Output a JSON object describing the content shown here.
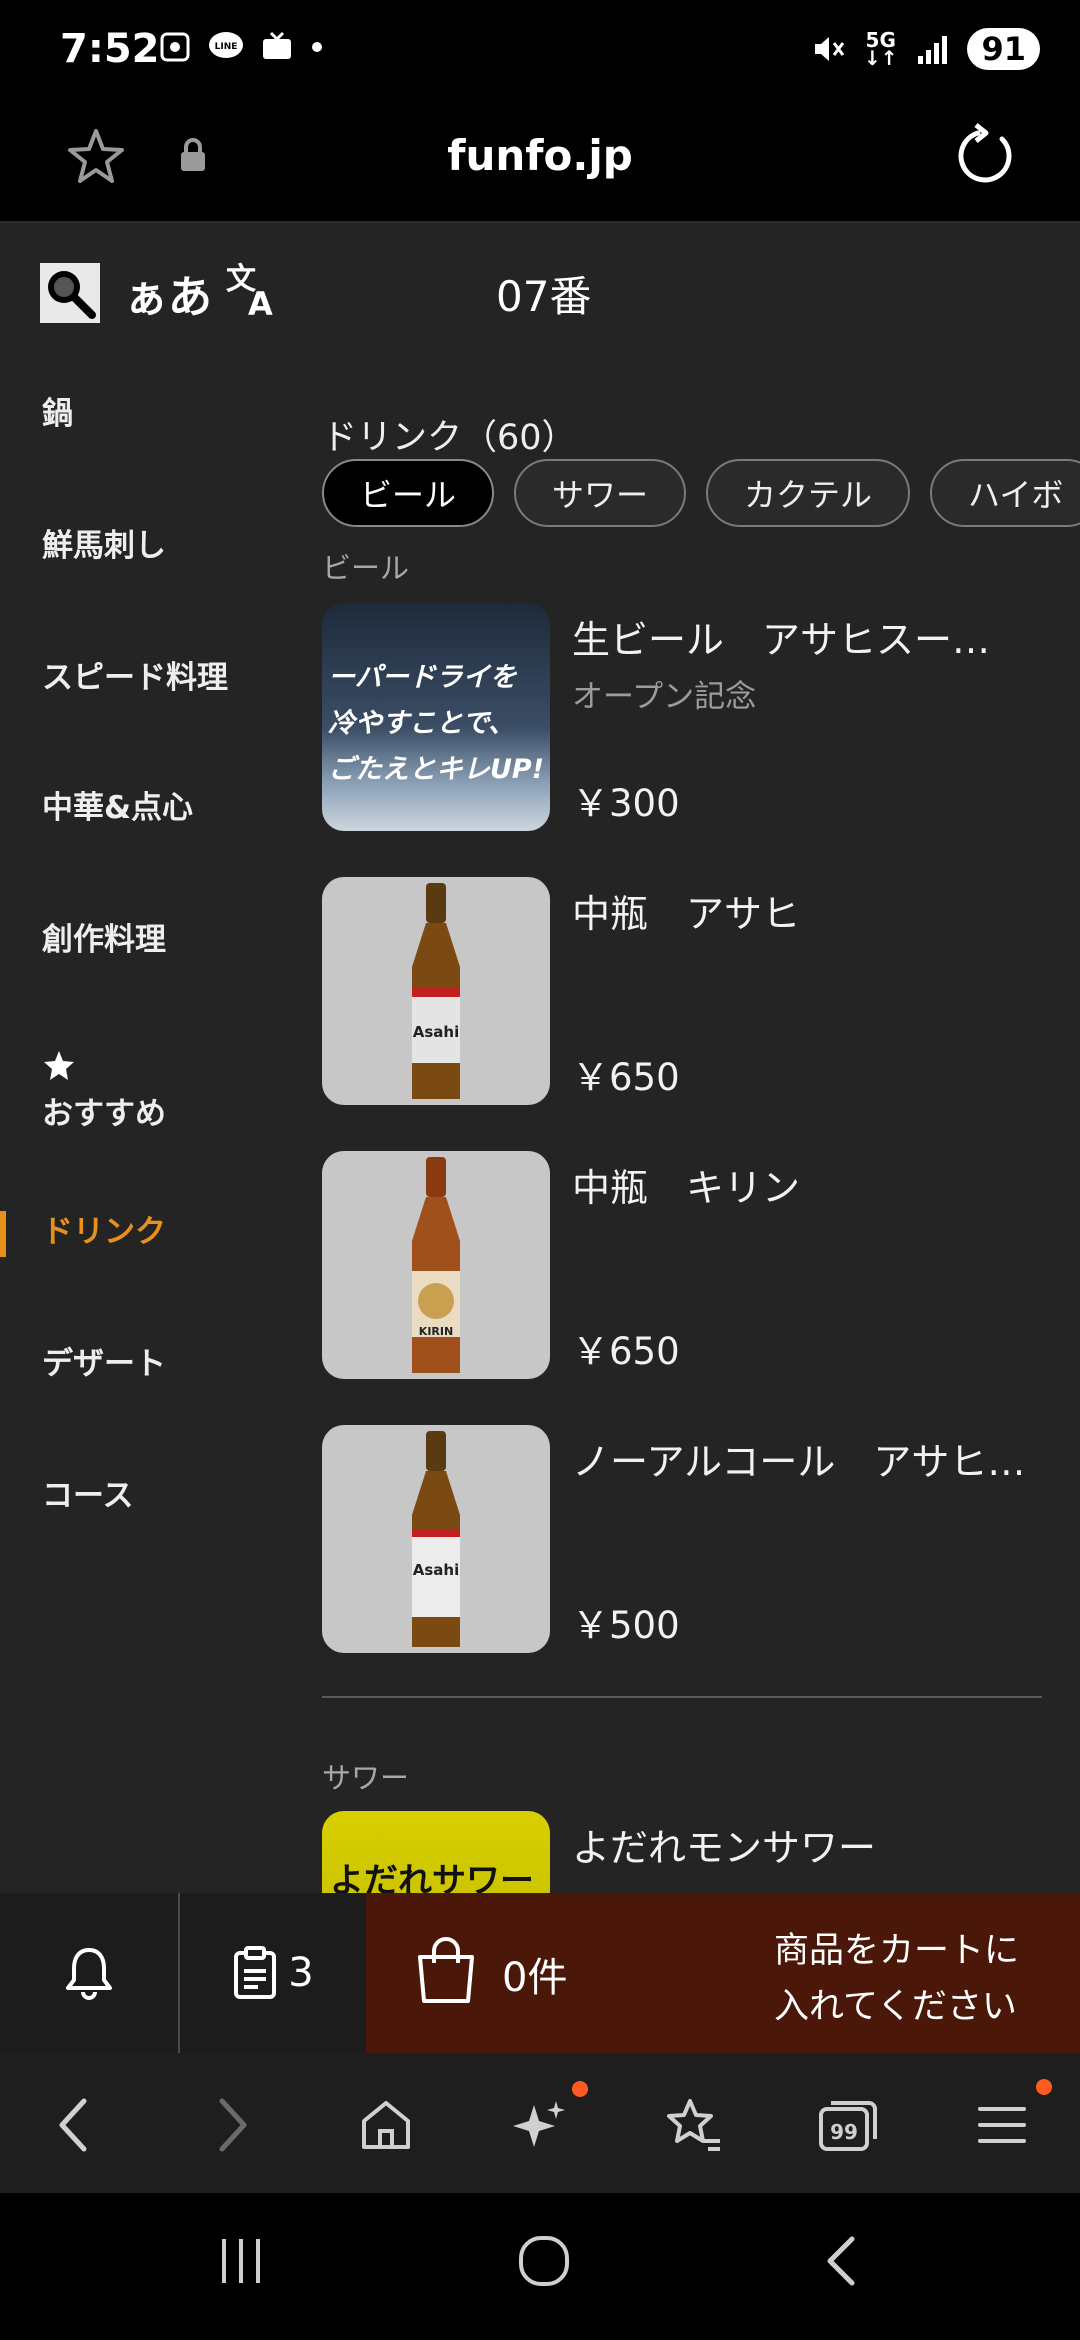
{
  "status": {
    "time": "7:52",
    "network": "5G",
    "battery": "91"
  },
  "browser": {
    "url": "funfo.jp"
  },
  "app": {
    "font_toggle": "ぁあ",
    "table_number": "07番",
    "sidebar": [
      {
        "label": "鍋",
        "active": false
      },
      {
        "label": "鮮馬刺し",
        "active": false
      },
      {
        "label": "スピード料理",
        "active": false
      },
      {
        "label": "中華&点心",
        "active": false
      },
      {
        "label": "創作料理",
        "active": false
      },
      {
        "label": "おすすめ",
        "active": false,
        "icon": "star-icon"
      },
      {
        "label": "ドリンク",
        "active": true
      },
      {
        "label": "デザート",
        "active": false
      },
      {
        "label": "コース",
        "active": false
      }
    ],
    "section_heading": "ドリンク（60）",
    "chips": [
      "ビール",
      "サワー",
      "カクテル",
      "ハイボ"
    ],
    "categories": {
      "beer": "ビール",
      "sour": "サワー"
    },
    "products": [
      {
        "name": "生ビール　アサヒスー…",
        "sub": "オープン記念",
        "price": "￥300",
        "thumb_text": [
          "ーパードライを",
          "冷やすことで、",
          "ごたえとキレUP!"
        ]
      },
      {
        "name": "中瓶　アサヒ",
        "sub": "",
        "price": "￥650",
        "bottle_label": "Asahi"
      },
      {
        "name": "中瓶　キリン",
        "sub": "",
        "price": "￥650",
        "bottle_label": "KIRIN"
      },
      {
        "name": "ノーアルコール　アサヒ…",
        "sub": "",
        "price": "￥500",
        "bottle_label": "Asahi"
      },
      {
        "name": "よだれモンサワー",
        "sub": "",
        "price": "",
        "thumb_text": [
          "よだれサワー"
        ]
      }
    ]
  },
  "cart": {
    "order_count": "3",
    "cart_count": "0件",
    "message_line1": "商品をカートに",
    "message_line2": "入れてください"
  },
  "colors": {
    "accent": "#e8911a",
    "cart_bg": "#4b1709",
    "badge": "#ff5a1f"
  }
}
